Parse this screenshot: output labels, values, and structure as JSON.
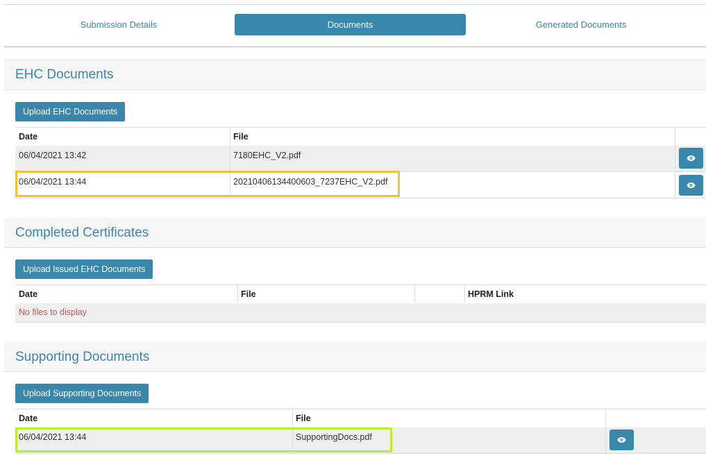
{
  "tabs": [
    {
      "label": "Submission Details",
      "active": false
    },
    {
      "label": "Documents",
      "active": true
    },
    {
      "label": "Generated Documents",
      "active": false
    }
  ],
  "ehc": {
    "title": "EHC Documents",
    "upload_label": "Upload EHC Documents",
    "headers": {
      "date": "Date",
      "file": "File"
    },
    "rows": [
      {
        "date": "06/04/2021 13:42",
        "file": "7180EHC_V2.pdf"
      },
      {
        "date": "06/04/2021 13:44",
        "file": "20210406134400603_7237EHC_V2.pdf"
      }
    ]
  },
  "completed": {
    "title": "Completed Certificates",
    "upload_label": "Upload Issued EHC Documents",
    "headers": {
      "date": "Date",
      "file": "File",
      "hprm": "HPRM Link"
    },
    "empty_text": "No files to display"
  },
  "supporting": {
    "title": "Supporting Documents",
    "upload_label": "Upload Supporting Documents",
    "headers": {
      "date": "Date",
      "file": "File"
    },
    "rows": [
      {
        "date": "06/04/2021 13:44",
        "file": "SupportingDocs.pdf"
      }
    ]
  },
  "colors": {
    "accent": "#3a87ad",
    "highlight_yellow": "#f5c12e",
    "highlight_green": "#b8f02a",
    "empty_text": "#d9534f"
  },
  "icons": {
    "view": "eye-icon"
  }
}
